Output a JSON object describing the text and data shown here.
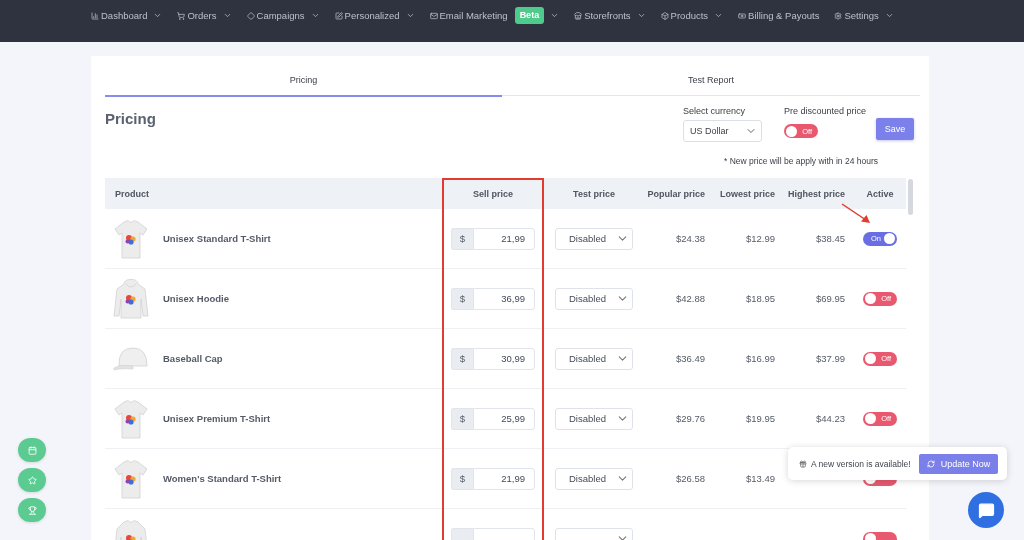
{
  "nav": {
    "items": [
      {
        "label": "Dashboard",
        "dropdown": true
      },
      {
        "label": "Orders",
        "dropdown": true
      },
      {
        "label": "Campaigns",
        "dropdown": true
      },
      {
        "label": "Personalized",
        "dropdown": true
      },
      {
        "label": "Email Marketing",
        "badge": "Beta",
        "dropdown": true
      },
      {
        "label": "Storefronts",
        "dropdown": true
      },
      {
        "label": "Products",
        "dropdown": true
      },
      {
        "label": "Billing & Payouts",
        "dropdown": false
      },
      {
        "label": "Settings",
        "dropdown": true
      }
    ]
  },
  "tabs": [
    {
      "label": "Pricing",
      "selected": true
    },
    {
      "label": "Test Report",
      "selected": false
    }
  ],
  "heading": "Pricing",
  "currency": {
    "label": "Select currency",
    "value": "US Dollar"
  },
  "pre_discounted_price": {
    "label": "Pre discounted price",
    "on": false,
    "state_label": "Off"
  },
  "save_button": "Save",
  "note": "* New price will be apply with in 24 hours",
  "table": {
    "columns": [
      {
        "label": "Product",
        "highlighted": false
      },
      {
        "label": "Sell price",
        "highlighted": true
      },
      {
        "label": "Test price",
        "highlighted": false
      },
      {
        "label": "Popular price",
        "highlighted": false
      },
      {
        "label": "Lowest price",
        "highlighted": false
      },
      {
        "label": "Highest price",
        "highlighted": false
      },
      {
        "label": "Active",
        "highlighted": false
      }
    ],
    "rows": [
      {
        "kind": "tshirt",
        "product": "Unisex Standard T-Shirt",
        "currency": "$",
        "sell_price": "21,99",
        "test_price": "Disabled",
        "popular_price": "$24.38",
        "lowest_price": "$12.99",
        "highest_price": "$38.45",
        "active": true,
        "active_label": "On"
      },
      {
        "kind": "hoodie",
        "product": "Unisex Hoodie",
        "currency": "$",
        "sell_price": "36,99",
        "test_price": "Disabled",
        "popular_price": "$42.88",
        "lowest_price": "$18.95",
        "highest_price": "$69.95",
        "active": false,
        "active_label": "Off"
      },
      {
        "kind": "cap",
        "product": "Baseball Cap",
        "currency": "$",
        "sell_price": "30,99",
        "test_price": "Disabled",
        "popular_price": "$36.49",
        "lowest_price": "$16.99",
        "highest_price": "$37.99",
        "active": false,
        "active_label": "Off"
      },
      {
        "kind": "tshirt",
        "product": "Unisex Premium T-Shirt",
        "currency": "$",
        "sell_price": "25,99",
        "test_price": "Disabled",
        "popular_price": "$29.76",
        "lowest_price": "$19.95",
        "highest_price": "$44.23",
        "active": false,
        "active_label": "Off"
      },
      {
        "kind": "tshirt",
        "product": "Women's Standard T-Shirt",
        "currency": "$",
        "sell_price": "21,99",
        "test_price": "Disabled",
        "popular_price": "$26.58",
        "lowest_price": "$13.49",
        "active": false
      },
      {
        "kind": "sweatshirt",
        "active": false
      }
    ]
  },
  "notification": {
    "message": "A new version is available!",
    "button": "Update Now"
  }
}
